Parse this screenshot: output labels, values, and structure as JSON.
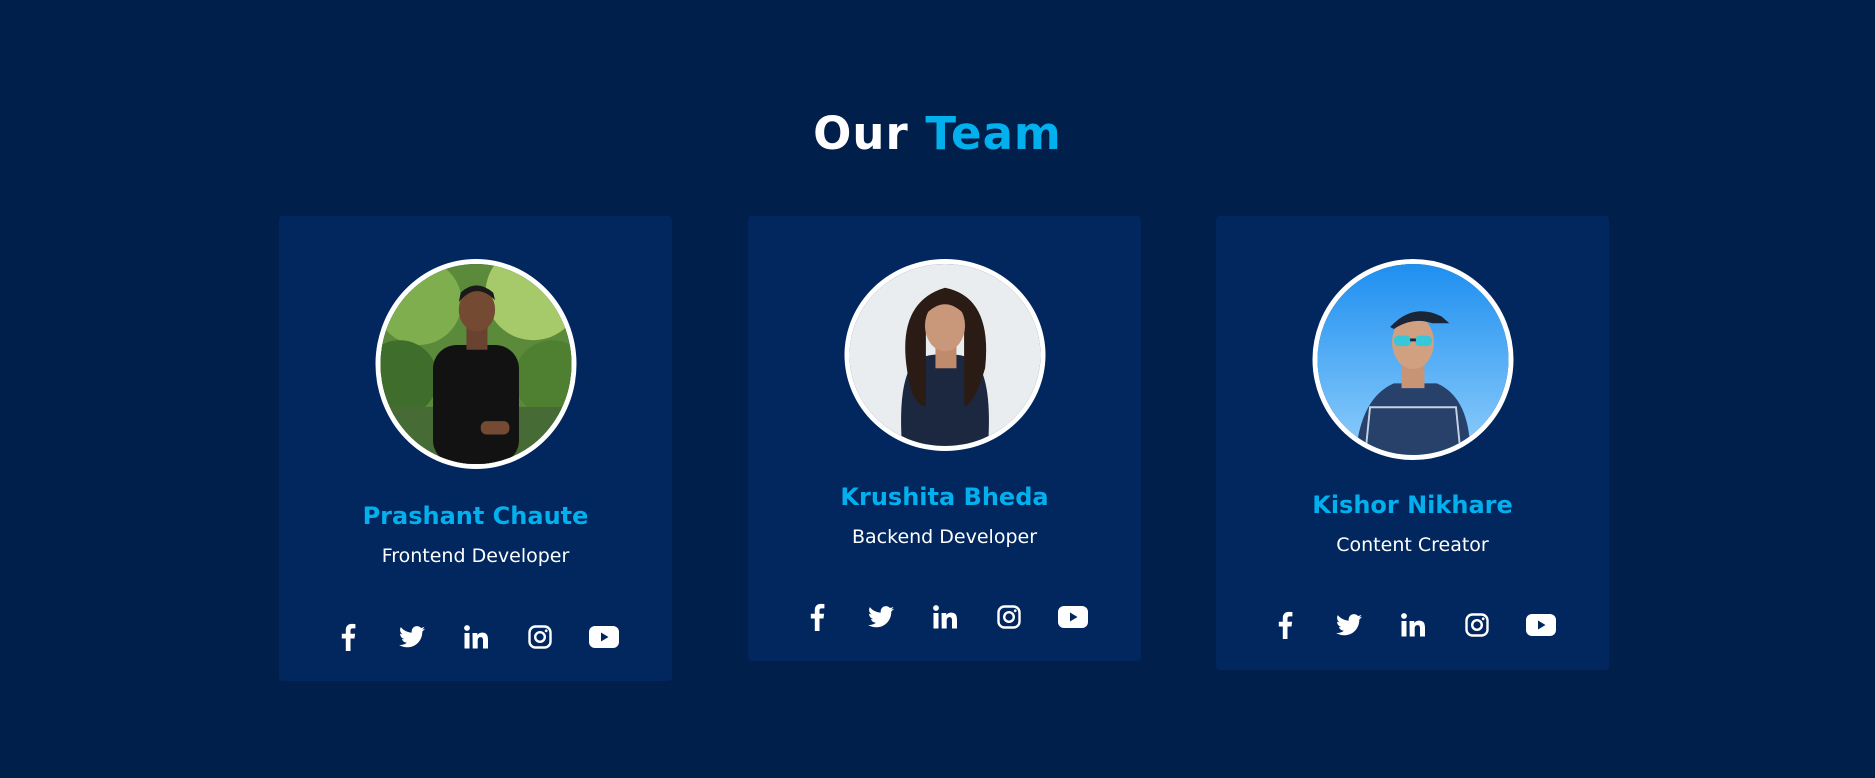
{
  "title": {
    "lead": "Our",
    "accent": "Team"
  },
  "colors": {
    "background": "#011f4b",
    "card": "#02275f",
    "accent": "#03b0ee",
    "text": "#ffffff"
  },
  "members": [
    {
      "name": "Prashant Chaute",
      "role": "Frontend Developer",
      "photo": "avatar-photo"
    },
    {
      "name": "Krushita Bheda",
      "role": "Backend Developer",
      "photo": "avatar-photo"
    },
    {
      "name": "Kishor Nikhare",
      "role": "Content Creator",
      "photo": "avatar-photo"
    }
  ],
  "socials": [
    "facebook-icon",
    "twitter-icon",
    "linkedin-icon",
    "instagram-icon",
    "youtube-icon"
  ]
}
